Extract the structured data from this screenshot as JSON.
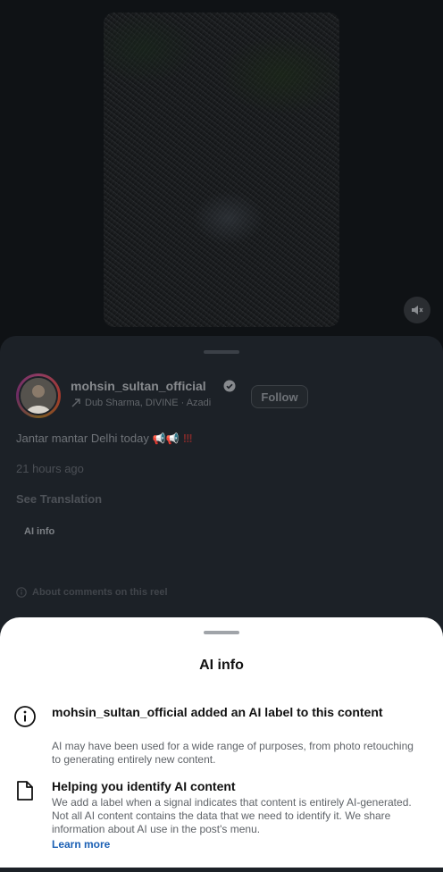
{
  "post": {
    "username": "mohsin_sultan_official",
    "audio": "Dub Sharma, DIVINE · Azadi",
    "follow_label": "Follow",
    "caption_text": "Jantar mantar Delhi today",
    "caption_emoji": "📢📢",
    "caption_marks": "!!!",
    "timestamp": "21 hours ago",
    "see_translation": "See Translation",
    "ai_info_label": "AI info",
    "about_comments": "About comments on this reel"
  },
  "ai_sheet": {
    "title": "AI info",
    "row1": {
      "username": "mohsin_sultan_official",
      "title_rest": " added an AI label to this content",
      "desc": "AI may have been used for a wide range of purposes, from photo retouching to generating entirely new content."
    },
    "row2": {
      "title": "Helping you identify AI content",
      "desc": "We add a label when a signal indicates that content is entirely AI-generated. Not all AI content contains the data that we need to identify it. We share information about AI use in the post's menu.",
      "learn_more": "Learn more"
    }
  },
  "icons": {
    "mute": "speaker-mute-icon",
    "verified": "verified-badge-icon",
    "audio": "trending-arrow-icon",
    "about": "info-circle-icon",
    "info": "info-circle-icon",
    "doc": "document-icon"
  },
  "colors": {
    "link": "#1a5fb4",
    "accent_ring": "#8e3b63"
  }
}
